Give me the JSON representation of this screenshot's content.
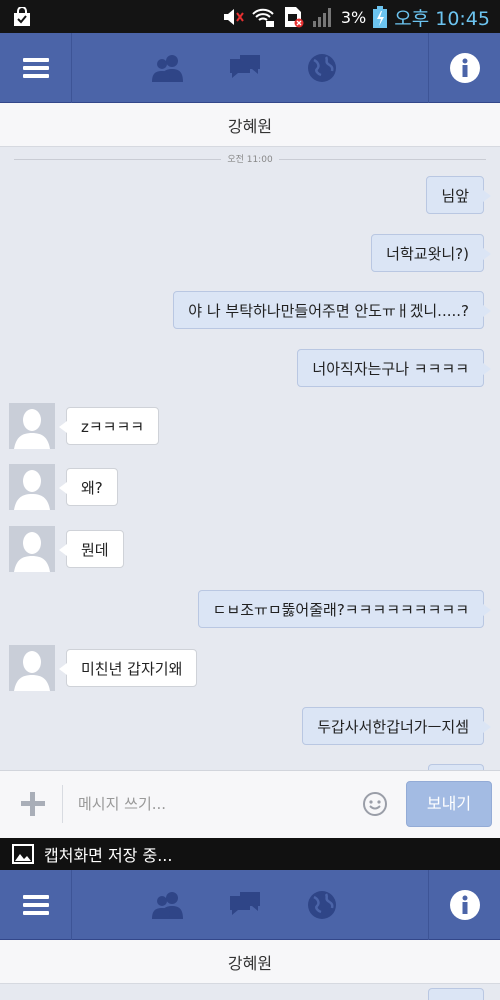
{
  "status_bar": {
    "battery_percent": "3%",
    "time": "오후 10:45",
    "icons": [
      "shopping-bag-icon",
      "volume-muted-icon",
      "wifi-locked-icon",
      "sim-error-icon",
      "signal-icon",
      "battery-charging-icon"
    ]
  },
  "app_bar": {
    "menu_icon": "hamburger-icon",
    "tabs": [
      "friends-icon",
      "messages-icon",
      "globe-icon"
    ],
    "info_icon": "info-icon"
  },
  "conversation": {
    "title": "강혜원",
    "timestamp": "오전 11:00",
    "messages": [
      {
        "from": "me",
        "text": "님앞"
      },
      {
        "from": "me",
        "text": "너학교왓니?)"
      },
      {
        "from": "me",
        "text": "야 나 부탁하나만들어주면 안도ㅠㅐ겠니.....?"
      },
      {
        "from": "me",
        "text": "너아직자는구나 ㅋㅋㅋㅋ"
      },
      {
        "from": "other",
        "text": "zㅋㅋㅋㅋ"
      },
      {
        "from": "other",
        "text": "왜?"
      },
      {
        "from": "other",
        "text": "뭔데"
      },
      {
        "from": "me",
        "text": "ㄷㅂ조ㅠㅁ뚫어줄래?ㅋㅋㅋㅋㅋㅋㅋㅋㅋ"
      },
      {
        "from": "other",
        "text": "미친년 갑자기왜"
      },
      {
        "from": "me",
        "text": "두갑사서한갑너가ㅡ지셈"
      }
    ]
  },
  "composer": {
    "placeholder": "메시지 쓰기...",
    "send_label": "보내기"
  },
  "notification": {
    "text": "캡처화면 저장 중..."
  },
  "colors": {
    "app_bar": "#4b64a8",
    "my_bubble": "#dbe5f5",
    "other_bubble": "#ffffff",
    "send_button": "#a3bbe3",
    "clock": "#6cc4f0"
  }
}
